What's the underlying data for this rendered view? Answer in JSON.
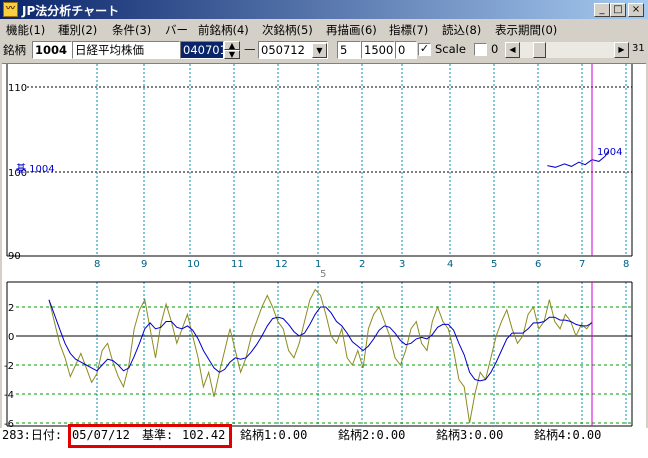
{
  "window": {
    "title": "JP法分析チャート",
    "app_icon": "chart-app-icon"
  },
  "titlebar_buttons": [
    "_",
    "□",
    "×"
  ],
  "menu": [
    "機能(1)",
    "種別(2)",
    "条件(3)",
    "バー",
    "前銘柄(4)",
    "次銘柄(5)",
    "再描画(6)",
    "指標(7)",
    "読込(8)",
    "表示期間(0)"
  ],
  "toolbar": {
    "stock_label": "銘柄",
    "code": "1004",
    "name": "日経平均株価",
    "from_date": "040701",
    "dash": "—",
    "to_date": "050712",
    "param1": "5",
    "param2": "1500",
    "param3": "0",
    "scale_checked": "✓",
    "scale_label": "Scale",
    "zero_checked": "",
    "zero_label": "0",
    "slider_value": "31"
  },
  "upper_chart": {
    "y_ticks": [
      "110",
      "100",
      "90"
    ],
    "x_months": [
      "8",
      "9",
      "10",
      "11",
      "12",
      "1",
      "2",
      "3",
      "4",
      "5",
      "6",
      "7",
      "8"
    ],
    "year_label": "5",
    "series_label_left": "基 1004",
    "series_label_right": "1004"
  },
  "lower_chart": {
    "y_ticks": [
      "2",
      "0",
      "-2",
      "-4",
      "-6"
    ]
  },
  "chart_data": {
    "type": "line",
    "upper_series": {
      "name": "1004",
      "points": [
        [
          0.0,
          100.0
        ],
        [
          0.8645,
          100.7
        ],
        [
          0.8775,
          100.5
        ],
        [
          0.892,
          100.9
        ],
        [
          0.903,
          100.6
        ],
        [
          0.915,
          101.1
        ],
        [
          0.925,
          100.8
        ],
        [
          0.936,
          101.4
        ],
        [
          0.947,
          101.2
        ],
        [
          0.957,
          101.8
        ],
        [
          0.962,
          102.4
        ]
      ]
    },
    "lower_series": [
      {
        "name": "oscillator",
        "color": "#8b8b20",
        "values": [
          2.5,
          1.0,
          -0.5,
          -1.5,
          -2.8,
          -2.0,
          -1.2,
          -2.2,
          -3.2,
          -2.6,
          -1.0,
          -0.5,
          -1.8,
          -2.8,
          -3.5,
          -2.0,
          0.5,
          1.8,
          2.5,
          0.5,
          -1.5,
          0.8,
          2.2,
          1.0,
          -0.5,
          0.5,
          1.5,
          0.0,
          -1.5,
          -3.5,
          -2.5,
          -4.2,
          -2.5,
          -1.0,
          0.5,
          -1.0,
          -2.5,
          -1.5,
          0.0,
          1.0,
          2.0,
          2.8,
          2.0,
          1.0,
          0.5,
          -1.0,
          -1.5,
          -0.5,
          1.0,
          2.5,
          3.2,
          2.8,
          1.5,
          0.0,
          -0.5,
          0.5,
          -1.5,
          -2.0,
          -1.0,
          -2.2,
          0.5,
          1.5,
          2.0,
          1.0,
          0.0,
          -1.5,
          -2.0,
          -1.0,
          0.5,
          1.0,
          -0.5,
          -1.0,
          1.0,
          2.0,
          1.0,
          0.5,
          -1.0,
          -3.0,
          -3.5,
          -6.0,
          -4.0,
          -2.5,
          -3.0,
          -1.5,
          0.0,
          1.0,
          1.8,
          0.5,
          -0.5,
          0.0,
          1.5,
          2.0,
          0.5,
          1.0,
          2.5,
          1.0,
          0.5,
          1.5,
          1.0,
          0.0,
          0.8,
          0.5,
          1.0
        ]
      },
      {
        "name": "average",
        "color": "#0000cc",
        "values": [
          2.5,
          1.5,
          0.5,
          -0.5,
          -1.2,
          -1.6,
          -1.8,
          -2.0,
          -2.2,
          -2.4,
          -2.0,
          -1.6,
          -1.7,
          -2.0,
          -2.4,
          -2.2,
          -1.4,
          -0.5,
          0.5,
          0.9,
          0.5,
          0.6,
          1.0,
          1.0,
          0.6,
          0.5,
          0.7,
          0.4,
          -0.2,
          -1.0,
          -1.6,
          -2.2,
          -2.5,
          -2.3,
          -1.8,
          -1.5,
          -1.6,
          -1.5,
          -1.1,
          -0.6,
          0.0,
          0.7,
          1.2,
          1.3,
          1.2,
          0.8,
          0.3,
          0.0,
          0.2,
          0.8,
          1.5,
          2.0,
          2.0,
          1.6,
          1.0,
          0.7,
          0.2,
          -0.4,
          -0.7,
          -1.0,
          -0.7,
          -0.2,
          0.4,
          0.7,
          0.6,
          0.2,
          -0.3,
          -0.6,
          -0.5,
          -0.2,
          -0.1,
          -0.2,
          0.1,
          0.6,
          0.8,
          0.8,
          0.4,
          -0.5,
          -1.3,
          -2.5,
          -3.0,
          -3.1,
          -3.0,
          -2.5,
          -1.8,
          -1.0,
          -0.2,
          0.2,
          0.2,
          0.2,
          0.5,
          0.9,
          0.9,
          1.0,
          1.3,
          1.3,
          1.1,
          1.1,
          1.0,
          0.8,
          0.7,
          0.7,
          0.9
        ]
      }
    ]
  },
  "status": {
    "prefix": "283:日付:",
    "date": "05/07/12",
    "base_label": "基準:",
    "base_value": "102.42",
    "stock1": "銘柄1:0.00",
    "stock2": "銘柄2:0.00",
    "stock3": "銘柄3:0.00",
    "stock4": "銘柄4:0.00"
  }
}
